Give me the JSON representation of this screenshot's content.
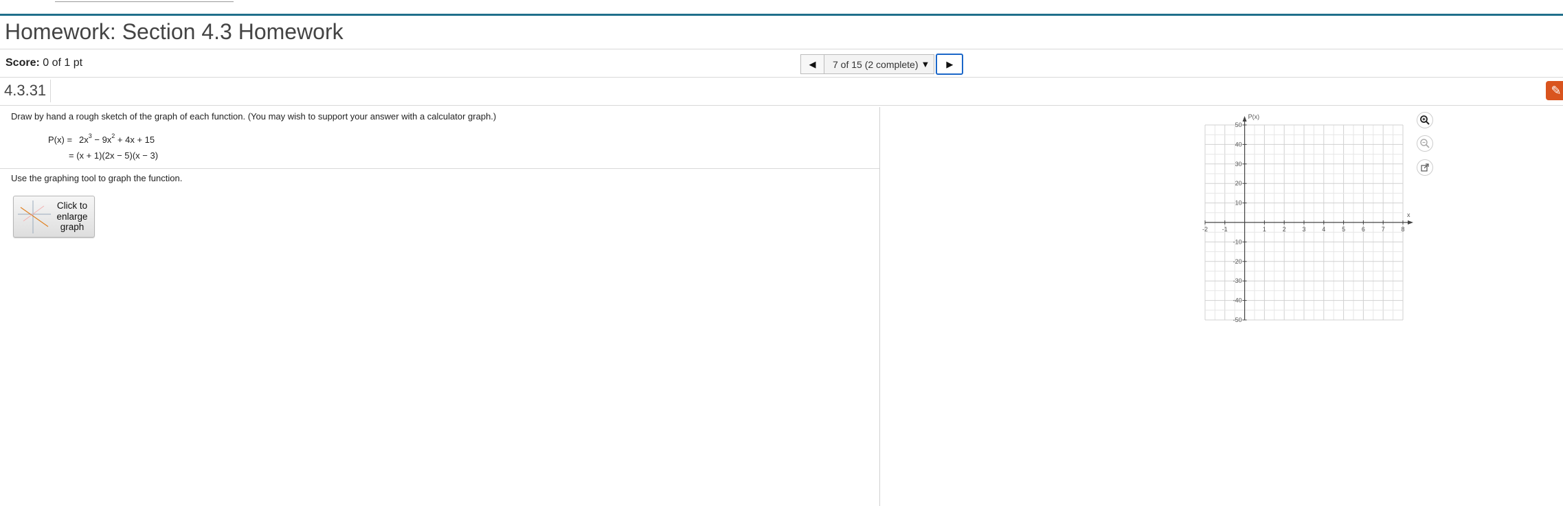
{
  "header": {
    "title": "Homework: Section 4.3 Homework",
    "score_label": "Score:",
    "score_value": "0 of 1 pt"
  },
  "navigation": {
    "progress_text": "7 of 15 (2 complete)",
    "prev_icon": "triangle-left-icon",
    "next_icon": "triangle-right-icon",
    "dropdown_icon": "triangle-down-icon"
  },
  "question": {
    "number": "4.3.31",
    "instruction": "Draw by hand a rough sketch of the graph of each function. (You may wish to support your answer with a calculator graph.)",
    "function_lhs": "P(x) =",
    "function_line1": {
      "c1": "2x",
      "e1": "3",
      "c2": " − 9x",
      "e2": "2",
      "c3": " + 4x + 15"
    },
    "function_line2": "= (x + 1)(2x − 5)(x − 3)",
    "tool_text": "Use the graphing tool to graph the function.",
    "enlarge_label": "Click to enlarge graph"
  },
  "graph": {
    "y_axis_label": "P(x)",
    "x_axis_label": "x",
    "x_range": [
      -2,
      8
    ],
    "y_range": [
      -50,
      50
    ],
    "x_ticks": [
      "-2",
      "-1",
      "1",
      "2",
      "3",
      "4",
      "5",
      "6",
      "7",
      "8"
    ],
    "y_ticks": [
      "50",
      "40",
      "30",
      "20",
      "10",
      "-10",
      "-20",
      "-30",
      "-40",
      "-50"
    ],
    "tools": [
      "zoom-in-icon",
      "zoom-out-icon",
      "popout-icon"
    ]
  },
  "colors": {
    "accent_line": "#1f6f8b",
    "focus_border": "#1a66c8",
    "help_tab": "#d9541e"
  }
}
